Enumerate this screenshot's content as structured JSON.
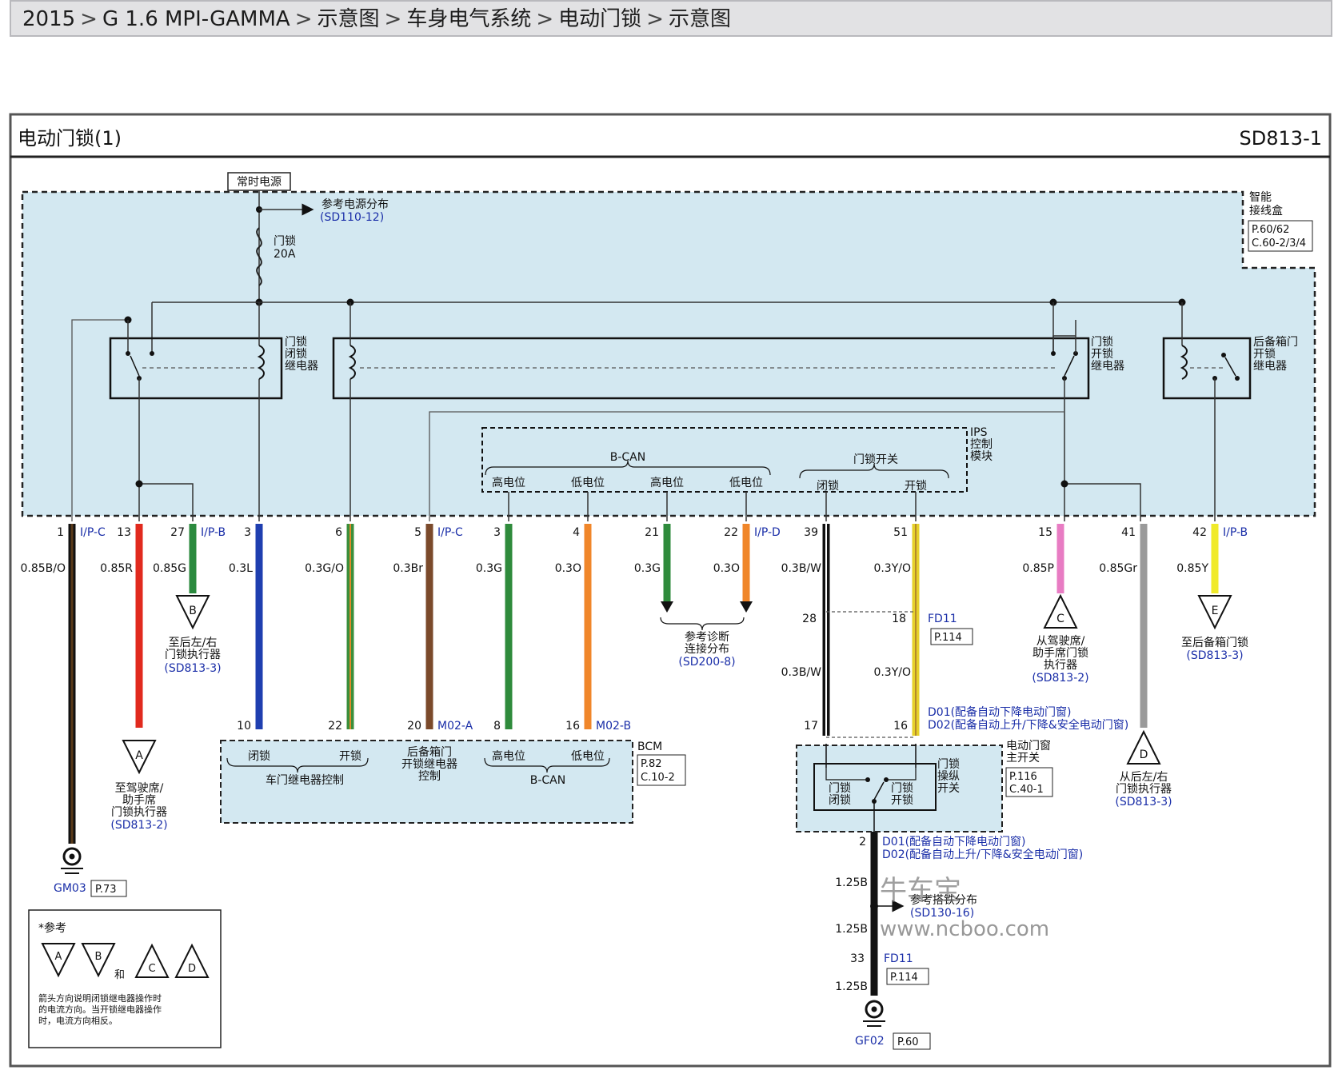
{
  "breadcrumb": [
    "2015",
    "G 1.6 MPI-GAMMA",
    "示意图",
    "车身电气系统",
    "电动门锁",
    "示意图"
  ],
  "diagram": {
    "title": "电动门锁(1)",
    "code": "SD813-1",
    "battery_label": "常时电源",
    "power_ref": {
      "text": "参考电源分布",
      "link": "(SD110-12)"
    },
    "fuse": {
      "name": "门锁",
      "rating": "20A"
    },
    "smart_junction": {
      "name_1": "智能",
      "name_2": "接线盒",
      "ref_1": "P.60/62",
      "ref_2": "C.60-2/3/4"
    },
    "relays": {
      "lock": [
        "门锁",
        "闭锁",
        "继电器"
      ],
      "unlock": [
        "门锁",
        "开锁",
        "继电器"
      ],
      "tailgate": [
        "后备箱门",
        "开锁",
        "继电器"
      ]
    },
    "ips": [
      "IPS",
      "控制",
      "模块"
    ],
    "bcan_label": "B-CAN",
    "switch_label": "门锁开关",
    "high": "高电位",
    "low": "低电位",
    "lock_word": "闭锁",
    "unlock_word": "开锁",
    "pins": {
      "p1": "1",
      "c1": "I/P-C",
      "p13": "13",
      "p27": "27",
      "c27": "I/P-B",
      "p3": "3",
      "p6": "6",
      "p5": "5",
      "c5": "I/P-C",
      "p3b": "3",
      "p4": "4",
      "p21": "21",
      "p22": "22",
      "c22": "I/P-D",
      "p39": "39",
      "p51": "51",
      "p15": "15",
      "p41": "41",
      "p42": "42",
      "c42": "I/P-B"
    },
    "wires": {
      "w1": "0.85B/O",
      "w13": "0.85R",
      "w27": "0.85G",
      "w3": "0.3L",
      "w6": "0.3G/O",
      "w5": "0.3Br",
      "w3b": "0.3G",
      "w4": "0.3O",
      "w21": "0.3G",
      "w22": "0.3O",
      "w39": "0.3B/W",
      "w51": "0.3Y/O",
      "w15": "0.85P",
      "w41": "0.85Gr",
      "w42": "0.85Y",
      "w39b": "0.3B/W",
      "w51b": "0.3Y/O",
      "g1": "1.25B",
      "g2": "1.25B",
      "g3": "1.25B"
    },
    "fd11": {
      "p28": "28",
      "p18": "18",
      "name": "FD11",
      "ref": "P.114",
      "p33": "33",
      "name_b": "FD11",
      "ref_b": "P.114"
    },
    "bcm": {
      "label": "BCM",
      "ref_1": "P.82",
      "ref_2": "C.10-2",
      "p10": "10",
      "p22": "22",
      "p20": "20",
      "c20": "M02-A",
      "p8": "8",
      "p16": "16",
      "c16": "M02-B",
      "door_relay_ctrl": "车门继电器控制",
      "tail_1": "后备箱门",
      "tail_2": "开锁继电器",
      "tail_3": "控制",
      "bcan": "B-CAN"
    },
    "diag_ref": [
      "参考诊断",
      "连接分布",
      "(SD200-8)"
    ],
    "conn_B": {
      "letter": "B",
      "t1": "至后左/右",
      "t2": "门锁执行器",
      "link": "(SD813-3)"
    },
    "conn_C": {
      "letter": "C",
      "t1": "从驾驶席/",
      "t2": "助手席门锁",
      "t3": "执行器",
      "link": "(SD813-2)"
    },
    "conn_E": {
      "letter": "E",
      "t1": "至后备箱门锁",
      "link": "(SD813-3)"
    },
    "conn_A": {
      "letter": "A",
      "t1": "至驾驶席/",
      "t2": "助手席",
      "t3": "门锁执行器",
      "link": "(SD813-2)"
    },
    "conn_D": {
      "letter": "D",
      "t1": "从后左/右",
      "t2": "门锁执行器",
      "link": "(SD813-3)"
    },
    "note_d01": "D01(配备自动下降电动门窗)",
    "note_d02": "D02(配备自动上升/下降&安全电动门窗)",
    "window_switch": {
      "name_1": "电动门窗",
      "name_2": "主开关",
      "ref_1": "P.116",
      "ref_2": "C.40-1",
      "p17": "17",
      "p16": "16",
      "p2": "2",
      "lock_1": "门锁",
      "lock_2": "闭锁",
      "unlock_1": "门锁",
      "unlock_2": "开锁",
      "op_1": "门锁",
      "op_2": "操纵",
      "op_3": "开关"
    },
    "ground_ref": {
      "text": "参考搭铁分布",
      "link": "(SD130-16)"
    },
    "gm03": {
      "name": "GM03",
      "ref": "P.73"
    },
    "gf02": {
      "name": "GF02",
      "ref": "P.60"
    },
    "legend": {
      "title": "*参考",
      "a": "A",
      "b": "B",
      "c": "C",
      "d": "D",
      "and": "和",
      "line1": "箭头方向说明闭锁继电器操作时",
      "line2": "的电流方向。当开锁继电器操作",
      "line3": "时，电流方向相反。"
    },
    "watermark_1": "牛车宝",
    "watermark_2": "www.ncboo.com"
  }
}
